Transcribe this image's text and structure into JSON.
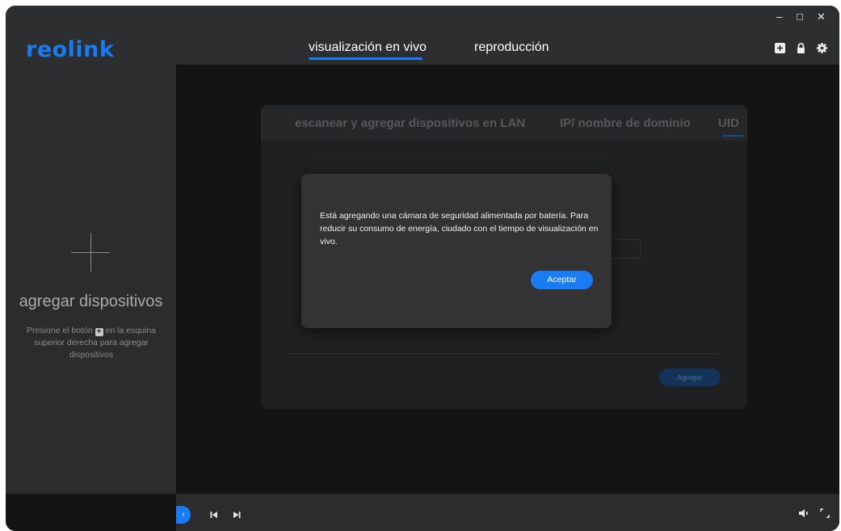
{
  "app": {
    "logo": "reolink"
  },
  "window_controls": {
    "minimize": "–",
    "maximize": "□",
    "close": "✕"
  },
  "header": {
    "tabs": [
      {
        "label": "visualización en vivo",
        "active": true
      },
      {
        "label": "reproducción",
        "active": false
      }
    ],
    "icons": [
      "add-device-icon",
      "lock-icon",
      "gear-icon"
    ]
  },
  "sidebar": {
    "title": "agregar dispositivos",
    "hint_before": "Presione el botón",
    "hint_after": "en la esquina superior derecha para agregar dispositivos",
    "hint_icon_glyph": "+"
  },
  "add_panel": {
    "tabs": [
      "escanear y agregar dispositivos en LAN",
      "IP/ nombre de dominio",
      "UID"
    ],
    "add_button": "Agregar"
  },
  "dialog": {
    "message": "Está agregando una cámara de seguridad alimentada por batería. Para reducir su consumo de energía, ciudado con el tiempo de visualización en vivo.",
    "accept_button": "Aceptar"
  },
  "bottombar": {
    "collapse_glyph": "‹",
    "prev_glyph": "⏮",
    "next_glyph": "⏭"
  },
  "colors": {
    "accent": "#1a7cf2",
    "titlebar": "#2d2e30",
    "sidebar": "#2c2c2e",
    "main": "#141414",
    "dialog": "#333335"
  }
}
